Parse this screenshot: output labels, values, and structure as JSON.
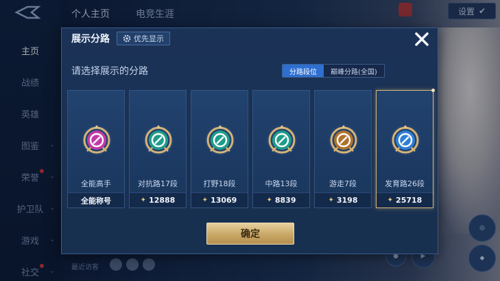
{
  "background": {
    "sidebar": [
      {
        "label": "主页",
        "active": true
      },
      {
        "label": "战绩"
      },
      {
        "label": "英雄"
      },
      {
        "label": "图鉴",
        "chevron": true
      },
      {
        "label": "荣誉",
        "chevron": true,
        "dot": true
      },
      {
        "label": "护卫队",
        "chevron": true
      },
      {
        "label": "游戏",
        "chevron": true
      },
      {
        "label": "社交",
        "chevron": true,
        "dot": true
      }
    ],
    "tabs": [
      "个人主页",
      "电竞生涯"
    ],
    "settings_label": "设置",
    "recent_label": "最近访客"
  },
  "modal": {
    "title": "展示分路",
    "priority_label": "优先显示",
    "subtitle": "请选择展示的分路",
    "seg_tabs": [
      {
        "label": "分路段位",
        "active": true
      },
      {
        "label": "巅峰分路(全国)",
        "active": false
      }
    ],
    "cards": [
      {
        "name": "全能高手",
        "footer": "全能称号",
        "icon": "all-round-badge-icon",
        "color": "#c23aa8"
      },
      {
        "name": "对抗路17段",
        "footer": "12888",
        "icon": "clash-lane-badge-icon",
        "color": "#1f9c8a"
      },
      {
        "name": "打野18段",
        "footer": "13069",
        "icon": "jungle-badge-icon",
        "color": "#1f9c8a"
      },
      {
        "name": "中路13段",
        "footer": "8839",
        "icon": "mid-lane-badge-icon",
        "color": "#1f9c8a"
      },
      {
        "name": "游走7段",
        "footer": "3198",
        "icon": "roam-badge-icon",
        "color": "#b0722c"
      },
      {
        "name": "发育路26段",
        "footer": "25718",
        "icon": "farm-lane-badge-icon",
        "color": "#2f7fd6",
        "selected": true
      }
    ],
    "confirm_label": "确定"
  }
}
